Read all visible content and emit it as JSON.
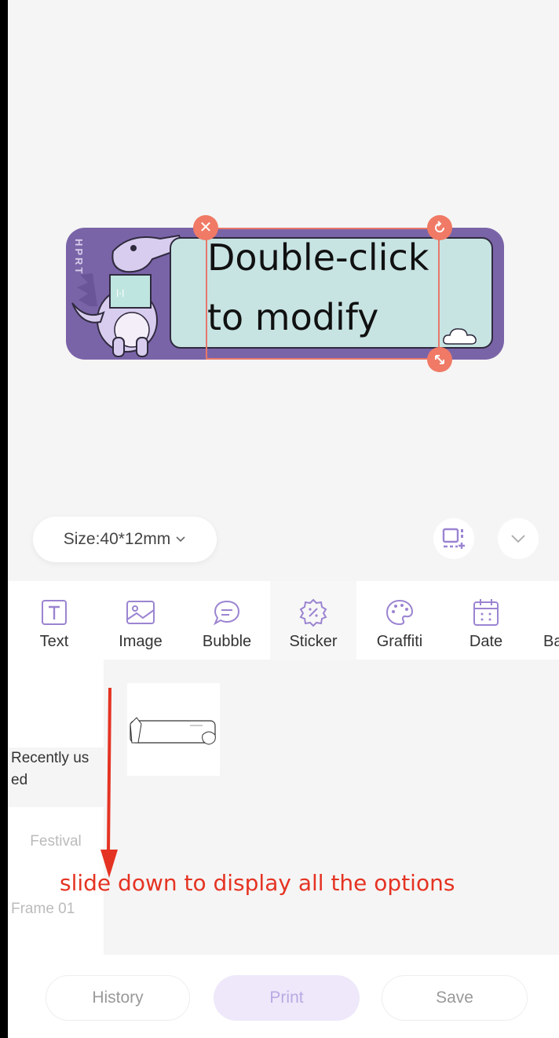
{
  "canvas": {
    "label_brand": "HPRT",
    "label_text": "Double-click\nto modify"
  },
  "size_selector": {
    "label": "Size:40*12mm"
  },
  "tools": [
    {
      "label": "Text",
      "icon": "text-icon"
    },
    {
      "label": "Image",
      "icon": "image-icon"
    },
    {
      "label": "Bubble",
      "icon": "bubble-icon"
    },
    {
      "label": "Sticker",
      "icon": "sticker-icon"
    },
    {
      "label": "Graffiti",
      "icon": "palette-icon"
    },
    {
      "label": "Date",
      "icon": "calendar-icon"
    },
    {
      "label": "Ba",
      "icon": ""
    }
  ],
  "categories": {
    "recently_used": "Recently us\ned",
    "festival": "Festival",
    "frame": "Frame 01"
  },
  "sticker_item": {
    "caption": ""
  },
  "annotation": "slide down to display all the options",
  "bottom": {
    "history": "History",
    "print": "Print",
    "save": "Save"
  },
  "colors": {
    "accent": "#f07a65",
    "label_purple": "#7a64a8",
    "label_mint": "#c7e4e3",
    "annotation_red": "#e53323",
    "tool_icon_purple": "#9b84d1"
  }
}
